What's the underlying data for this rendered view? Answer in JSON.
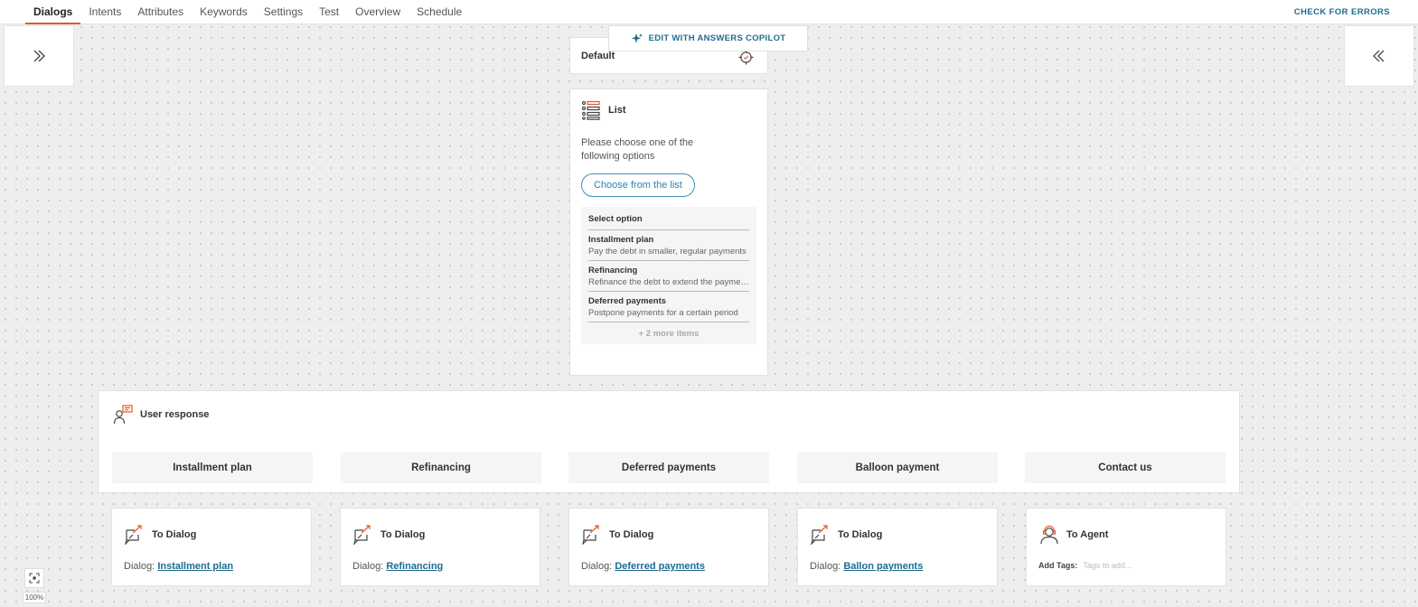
{
  "tabs": [
    "Dialogs",
    "Intents",
    "Attributes",
    "Keywords",
    "Settings",
    "Test",
    "Overview",
    "Schedule"
  ],
  "active_tab": "Dialogs",
  "check_errors_label": "CHECK FOR ERRORS",
  "copilot_label": "EDIT WITH ANSWERS COPILOT",
  "default_card": {
    "title": "Default"
  },
  "list_card": {
    "title": "List",
    "text": "Please choose one of the following options",
    "button_label": "Choose from the list",
    "options_title": "Select option",
    "options": [
      {
        "title": "Installment plan",
        "desc": "Pay the debt in smaller, regular payments"
      },
      {
        "title": "Refinancing",
        "desc": "Refinance the debt to extend the payment term"
      },
      {
        "title": "Deferred payments",
        "desc": "Postpone payments for a certain period"
      }
    ],
    "more_label": "+ 2 more items"
  },
  "user_response": {
    "title": "User response",
    "buttons": [
      "Installment plan",
      "Refinancing",
      "Deferred payments",
      "Balloon payment",
      "Contact us"
    ]
  },
  "destinations": [
    {
      "type": "dialog",
      "title": "To Dialog",
      "label": "Dialog:",
      "link": "Installment plan"
    },
    {
      "type": "dialog",
      "title": "To Dialog",
      "label": "Dialog:",
      "link": "Refinancing"
    },
    {
      "type": "dialog",
      "title": "To Dialog",
      "label": "Dialog:",
      "link": "Deferred payments"
    },
    {
      "type": "dialog",
      "title": "To Dialog",
      "label": "Dialog:",
      "link": "Ballon payments"
    },
    {
      "type": "agent",
      "title": "To Agent",
      "tags_label": "Add Tags:",
      "tags_placeholder": "Tags to add..."
    }
  ],
  "zoom_level": "100%",
  "colors": {
    "accent": "#e8562a",
    "link": "#1f6c8f",
    "canvas": "#eeeeee"
  }
}
